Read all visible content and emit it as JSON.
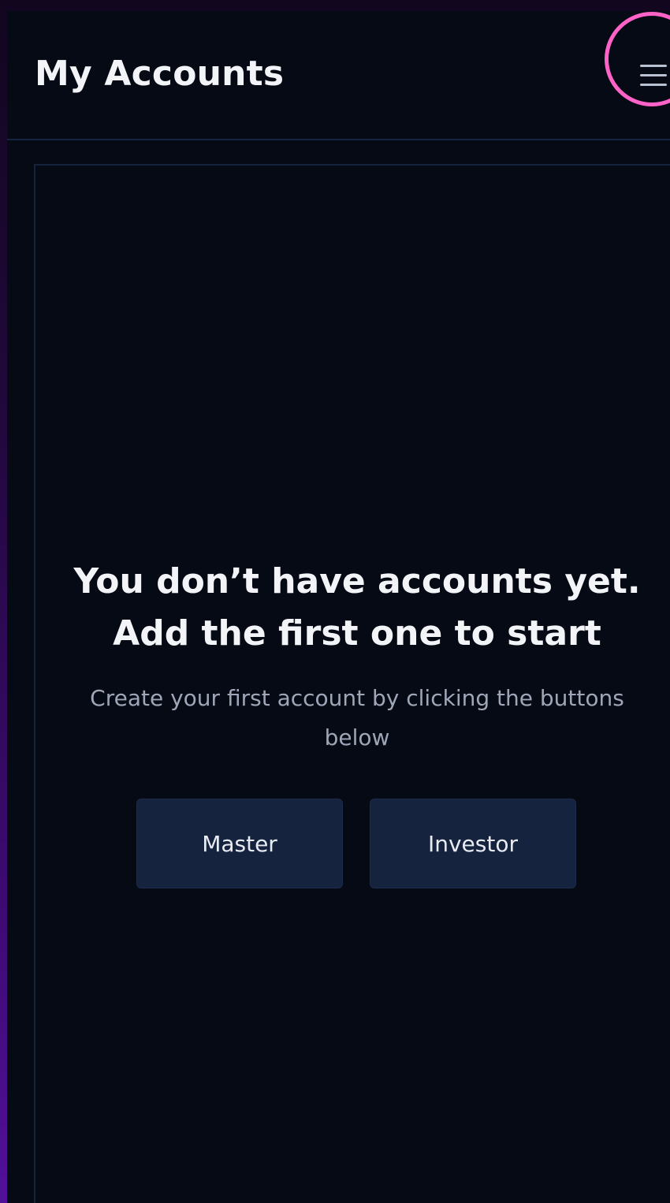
{
  "header": {
    "title": "My Accounts",
    "menu_icon": "hamburger-menu-icon",
    "highlight_color": "#ff63c8"
  },
  "empty_state": {
    "title_line1": "You don’t have accounts yet.",
    "title_line2": "Add the first one to start",
    "subtitle": "Create your first account by clicking the buttons below"
  },
  "actions": {
    "master_label": "Master",
    "investor_label": "Investor"
  },
  "colors": {
    "background": "#060a14",
    "button": "#15233f",
    "border": "#16243f"
  }
}
